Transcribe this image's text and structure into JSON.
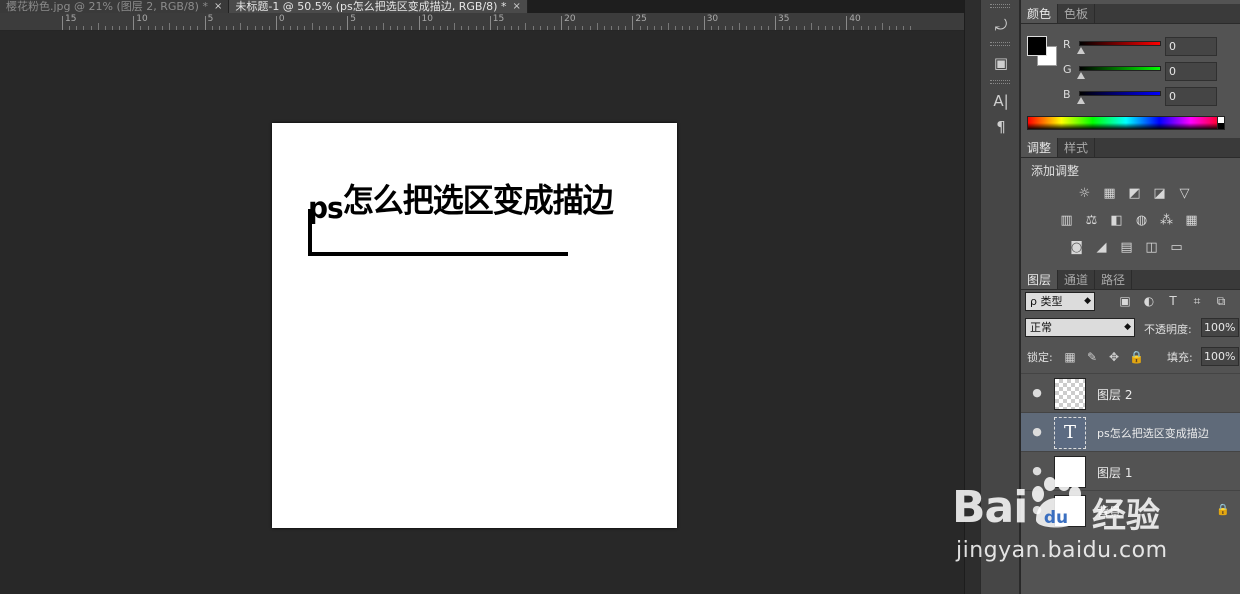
{
  "tabs": [
    {
      "label": "樱花粉色.jpg @ 21% (图层 2, RGB/8) *",
      "close": "×",
      "active": false
    },
    {
      "label": "未标题-1 @ 50.5% (ps怎么把选区变成描边, RGB/8) *",
      "close": "×",
      "active": true
    }
  ],
  "ruler": {
    "labels": [
      "15",
      "10",
      "5",
      "0",
      "5",
      "10",
      "15",
      "20",
      "25",
      "30",
      "35",
      "40"
    ]
  },
  "canvas": {
    "text_prefix": "ps",
    "text_main": "怎么把选区变成描边"
  },
  "toolcol": {
    "icons": [
      "history-icon",
      "3d-icon",
      "character-icon",
      "paragraph-icon"
    ],
    "glyphs": [
      "⤾",
      "▣",
      "A|",
      "¶"
    ]
  },
  "color_panel": {
    "tabs": [
      "颜色",
      "色板"
    ],
    "channels": [
      {
        "label": "R",
        "value": "0",
        "color": "#ff0000"
      },
      {
        "label": "G",
        "value": "0",
        "color": "#00ff00"
      },
      {
        "label": "B",
        "value": "0",
        "color": "#0000ff"
      }
    ]
  },
  "adjustments": {
    "tabs": [
      "调整",
      "样式"
    ],
    "title": "添加调整",
    "row1": [
      "☼",
      "▦",
      "◩",
      "◪",
      "▽"
    ],
    "row2": [
      "▥",
      "⚖",
      "◧",
      "◍",
      "⁂",
      "▦"
    ],
    "row3": [
      "◙",
      "◢",
      "▤",
      "◫",
      "▭"
    ]
  },
  "layers": {
    "tabs": [
      "图层",
      "通道",
      "路径"
    ],
    "filter_label": "ρ 类型",
    "filter_icons": [
      "▣",
      "◐",
      "T",
      "⌗",
      "⧉"
    ],
    "blend_mode": "正常",
    "opacity_label": "不透明度:",
    "opacity_value": "100%",
    "lock_label": "锁定:",
    "lock_icons": [
      "▦",
      "✎",
      "✥",
      "🔒"
    ],
    "fill_label": "填充:",
    "fill_value": "100%",
    "items": [
      {
        "name": "图层 2",
        "thumb": "checker",
        "selected": false,
        "eye": "●"
      },
      {
        "name": "ps怎么把选区变成描边",
        "thumb": "text",
        "thumb_glyph": "T",
        "selected": true,
        "eye": "●"
      },
      {
        "name": "图层 1",
        "thumb": "white",
        "selected": false,
        "eye": "●"
      },
      {
        "name": "背景",
        "thumb": "white",
        "selected": false,
        "eye": "●",
        "locked": "🔒"
      }
    ]
  },
  "watermark": {
    "logo": "Bai",
    "logo2": "du",
    "cn": "经验",
    "url": "jingyan.baidu.com"
  }
}
